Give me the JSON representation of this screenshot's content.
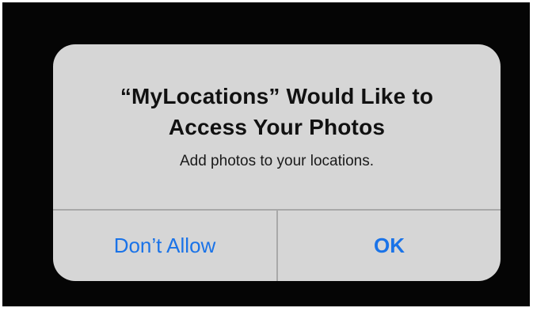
{
  "alert": {
    "title_line1": "“MyLocations” Would Like to",
    "title_line2": "Access Your Photos",
    "message": "Add photos to your locations.",
    "buttons": {
      "dont_allow": "Don’t Allow",
      "ok": "OK"
    }
  },
  "colors": {
    "backdrop": "#050505",
    "alert_background": "#d6d6d6",
    "button_text": "#1a73e8",
    "separator": "#a8a8a8"
  }
}
